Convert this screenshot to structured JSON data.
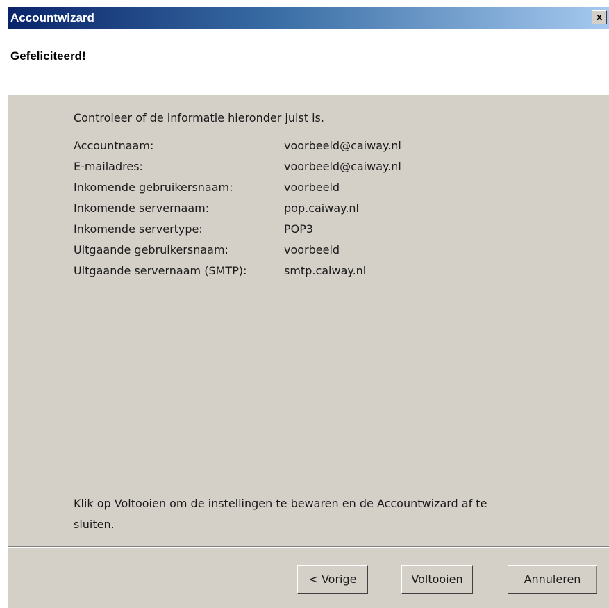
{
  "window": {
    "title": "Accountwizard",
    "close_label": "x"
  },
  "header": {
    "title": "Gefeliciteerd!"
  },
  "main": {
    "intro": "Controleer of de informatie hieronder juist is.",
    "rows": [
      {
        "label": "Accountnaam:",
        "value": "voorbeeld@caiway.nl"
      },
      {
        "label": "E-mailadres:",
        "value": "voorbeeld@caiway.nl"
      },
      {
        "label": "Inkomende gebruikersnaam:",
        "value": "voorbeeld"
      },
      {
        "label": "Inkomende servernaam:",
        "value": "pop.caiway.nl"
      },
      {
        "label": "Inkomende servertype:",
        "value": "POP3"
      },
      {
        "label": "Uitgaande gebruikersnaam:",
        "value": "voorbeeld"
      },
      {
        "label": "Uitgaande servernaam (SMTP):",
        "value": "smtp.caiway.nl"
      }
    ],
    "footer_line1": "Klik op Voltooien om de instellingen te bewaren en de Accountwizard af te",
    "footer_line2": "sluiten."
  },
  "buttons": {
    "back": "< Vorige",
    "finish": "Voltooien",
    "cancel": "Annuleren"
  },
  "colors": {
    "titlebar_start": "#0a246a",
    "titlebar_end": "#a6caf0",
    "dialog_face": "#d4d0c8"
  }
}
